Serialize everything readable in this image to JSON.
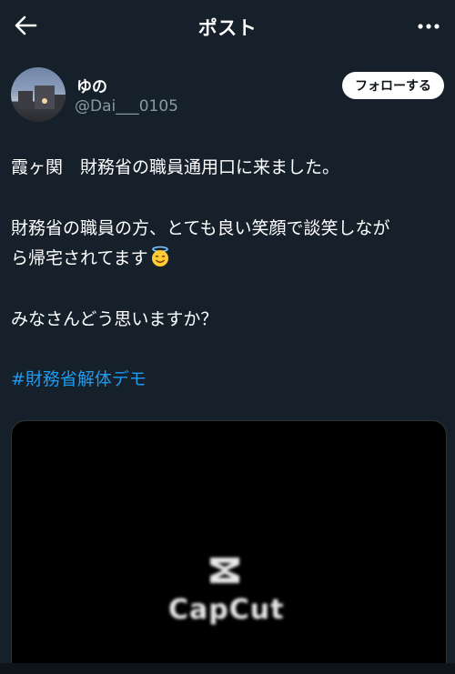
{
  "header": {
    "title": "ポスト",
    "back_icon": "back-arrow-icon",
    "more_icon": "more-horizontal-icon"
  },
  "author": {
    "display_name": "ゆの",
    "handle": "@Dai___0105",
    "follow_label": "フォローする"
  },
  "post": {
    "line1": "霞ヶ関　財務省の職員通用口に来ました。",
    "line2": "財務省の職員の方、とても良い笑顔で談笑しなが",
    "line3": "ら帰宅されてます",
    "emoji": "smiling-face-with-halo-icon",
    "line4": "みなさんどう思いますか？",
    "hashtag": "#財務省解体デモ"
  },
  "media": {
    "watermark_text": "CapCut",
    "watermark_icon": "capcut-logo-icon"
  },
  "colors": {
    "background": "#15202b",
    "text": "#ffffff",
    "secondary_text": "#8899a6",
    "link": "#1d9bf0",
    "button_bg": "#ffffff"
  }
}
